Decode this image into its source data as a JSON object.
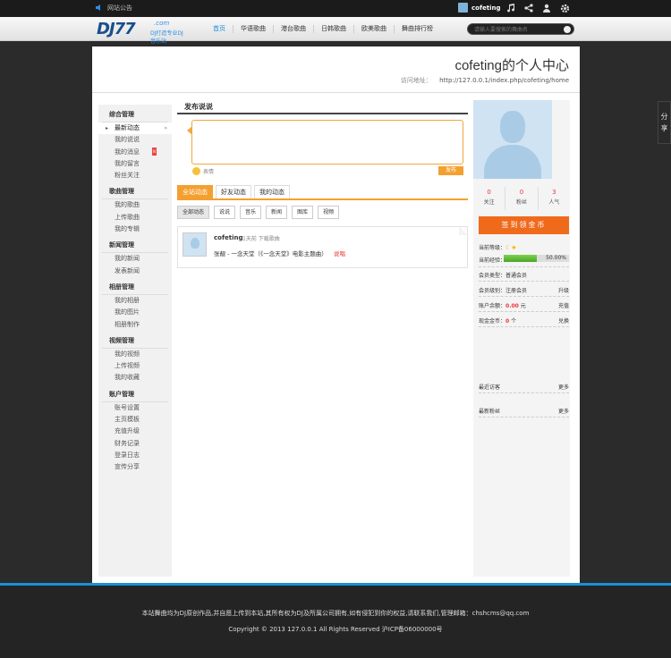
{
  "topbar": {
    "notice": "网站公告",
    "username": "cofeting"
  },
  "nav": {
    "logo_text": "DJ77",
    "logo_com": ".com",
    "logo_slogan": "DJ打造专业DJ音乐站",
    "items": [
      "首页",
      "华语歌曲",
      "港台歌曲",
      "日韩歌曲",
      "欧美歌曲",
      "舞曲排行榜"
    ],
    "search_placeholder": "请输入要搜索的舞曲名"
  },
  "header": {
    "title": "cofeting的个人中心",
    "url_label": "访问地址：",
    "url": "http://127.0.0.1/index.php/cofeting/home"
  },
  "sidebar": [
    {
      "title": "综合管理",
      "items": [
        "最新动态",
        "我的说说",
        "我的消息",
        "我的留言",
        "粉丝关注"
      ]
    },
    {
      "title": "歌曲管理",
      "items": [
        "我的歌曲",
        "上传歌曲",
        "我的专辑"
      ]
    },
    {
      "title": "新闻管理",
      "items": [
        "我的新闻",
        "发表新闻"
      ]
    },
    {
      "title": "相册管理",
      "items": [
        "我的相册",
        "我的图片",
        "相册制作"
      ]
    },
    {
      "title": "视频管理",
      "items": [
        "我的视频",
        "上传视频",
        "我的收藏"
      ]
    },
    {
      "title": "账户管理",
      "items": [
        "账号设置",
        "主页模板",
        "充值升级",
        "财务记录",
        "登录日志",
        "宣传分享"
      ]
    }
  ],
  "main": {
    "heading": "发布说说",
    "emoji_label": "表情",
    "publish": "发布",
    "tabs": [
      "全站动态",
      "好友动态",
      "我的动态"
    ],
    "filters": [
      "全部动态",
      "说说",
      "音乐",
      "新闻",
      "图库",
      "视频"
    ],
    "feed": {
      "user": "cofeting",
      "meta": "1天前 下载歌曲",
      "content": "张靓 - 一念天堂（《一念天堂》电影主题曲）",
      "report": "说唱"
    }
  },
  "right": {
    "stats": [
      {
        "n": "0",
        "l": "关注"
      },
      {
        "n": "0",
        "l": "粉丝"
      },
      {
        "n": "3",
        "l": "人气"
      }
    ],
    "sign_button": "签到领金币",
    "level_label": "当前等级：",
    "exp_label": "当前经验：",
    "exp_percent": 50,
    "exp_text": "50.00%",
    "member_type": "会员类型：普通会员",
    "member_level_label": "会员级别：注册会员",
    "upgrade": "升级",
    "balance_label": "账户余额：",
    "balance_value": "0.00",
    "balance_unit": "元",
    "recharge": "充值",
    "coins_label": "现金金币：",
    "coins_value": "0",
    "coins_unit": "个",
    "exchange": "兑换",
    "recent_visitors": "最近访客",
    "recent_fans": "最新粉丝",
    "more": "更多"
  },
  "share": "分享",
  "footer": {
    "line1": "本站舞曲均为DJ原创作品,并自愿上传到本站,其所有权为DJ及所属公司拥有,如有侵犯到你的权益,请联系我们,管理邮箱：chshcms@qq.com",
    "line2": "Copyright © 2013 127.0.0.1 All Rights Reserved 沪ICP备06000000号"
  }
}
